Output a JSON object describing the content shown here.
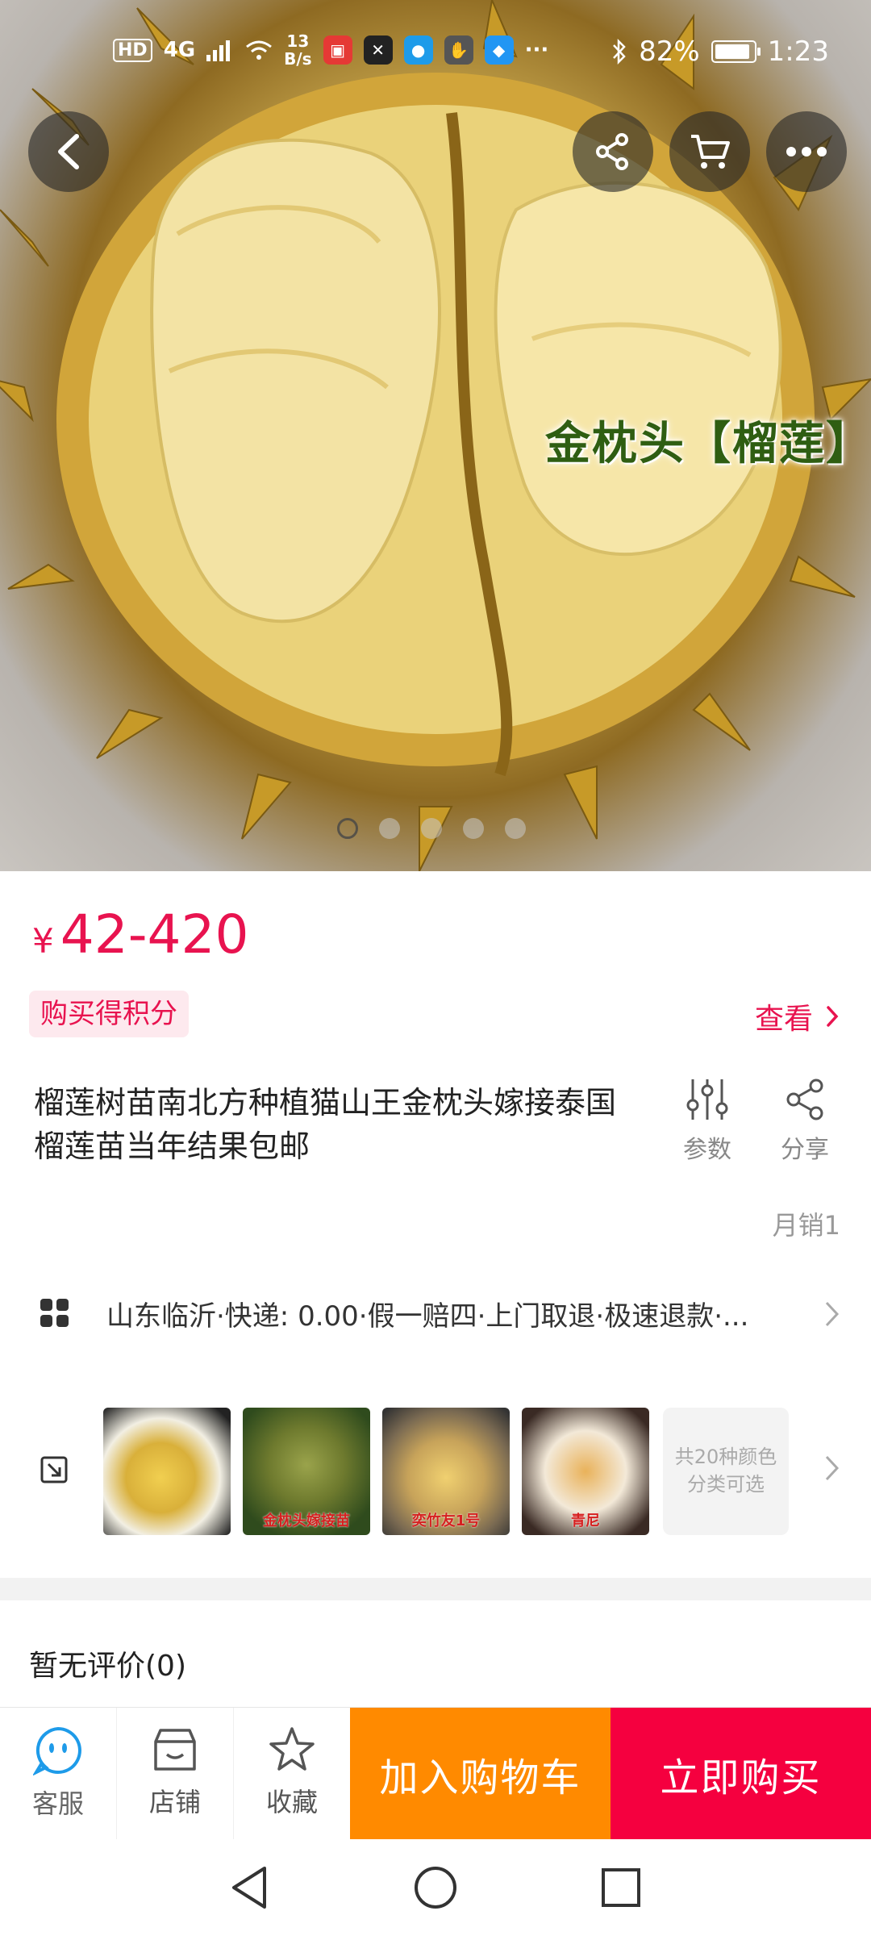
{
  "status_bar": {
    "hd": "HD",
    "network": "4G",
    "speed_value": "13",
    "speed_unit": "B/s",
    "more": "···",
    "battery": "82%",
    "time": "1:23"
  },
  "hero": {
    "caption": "金枕头【榴莲】",
    "image_count": 5,
    "active_index": 0
  },
  "top_actions": {
    "back": "back-icon",
    "share": "share-icon",
    "cart": "cart-icon",
    "more": "more-icon"
  },
  "price": {
    "currency": "¥",
    "value": "42-420"
  },
  "points_tag": "购买得积分",
  "view_link": "查看",
  "title": "榴莲树苗南北方种植猫山王金枕头嫁接泰国榴莲苗当年结果包邮",
  "actions": {
    "params": "参数",
    "share": "分享"
  },
  "monthly_sales": "月销1",
  "delivery_info": "山东临沂·快递: 0.00·假一赔四·上门取退·极速退款·...",
  "variants": {
    "thumbs": [
      {
        "label": ""
      },
      {
        "label": "金枕头嫁接苗"
      },
      {
        "label": "奕竹友1号"
      },
      {
        "label": "青尼"
      }
    ],
    "more_line1": "共20种颜色",
    "more_line2": "分类可选"
  },
  "reviews": "暂无评价(0)",
  "bottom_bar": {
    "service": "客服",
    "shop": "店铺",
    "favorite": "收藏",
    "add_to_cart": "加入购物车",
    "buy_now": "立即购买"
  },
  "colors": {
    "accent": "#e8134f",
    "cart_button": "#ff8a00",
    "buy_button": "#f5003f"
  }
}
